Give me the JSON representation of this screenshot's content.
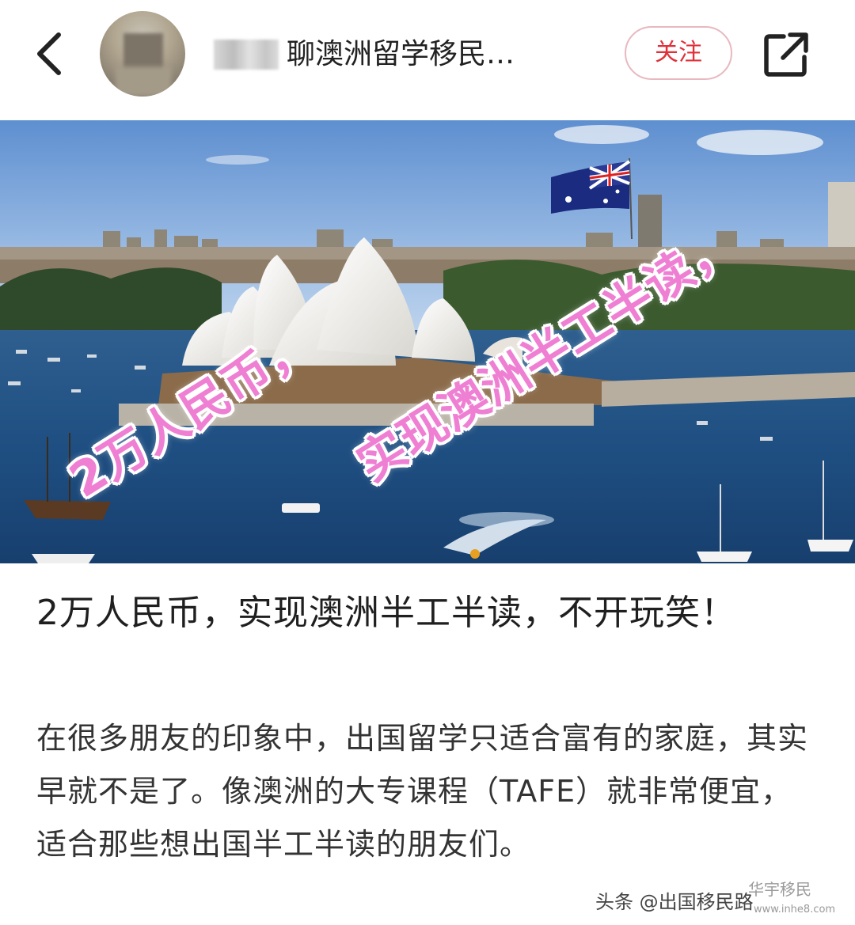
{
  "header": {
    "account_name": "聊澳洲留学移民…",
    "follow_label": "关注",
    "back_icon": "chevron-left-icon",
    "share_icon": "share-external-icon"
  },
  "hero": {
    "overlay_line_1": "2万人民币，",
    "overlay_line_2": "实现澳洲半工半读，",
    "overlay_color": "#ef7fd3"
  },
  "article": {
    "title": "2万人民币，实现澳洲半工半读，不开玩笑！",
    "body": "在很多朋友的印象中，出国留学只适合富有的家庭，其实早就不是了。像澳洲的大专课程（TAFE）就非常便宜，适合那些想出国半工半读的朋友们。"
  },
  "watermark": {
    "source": "头条 @出国移民路",
    "stamp": "华宇移民",
    "url": "www.inhe8.com"
  },
  "colors": {
    "accent": "#e0303a",
    "follow_border": "#e8b8bf"
  }
}
